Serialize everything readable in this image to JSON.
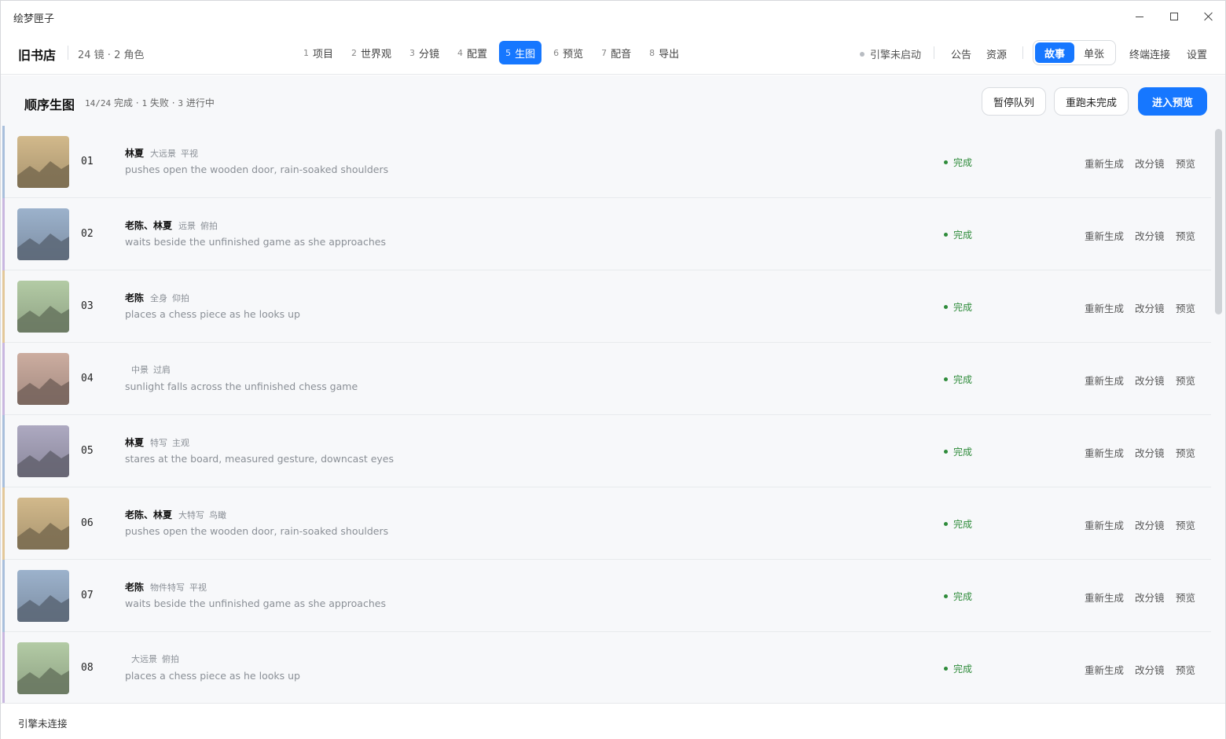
{
  "window": {
    "title": "绘梦匣子"
  },
  "project": {
    "name": "旧书店",
    "meta": "24 镜 · 2 角色"
  },
  "steps": [
    {
      "num": "1",
      "label": "项目",
      "active": false
    },
    {
      "num": "2",
      "label": "世界观",
      "active": false
    },
    {
      "num": "3",
      "label": "分镜",
      "active": false
    },
    {
      "num": "4",
      "label": "配置",
      "active": false
    },
    {
      "num": "5",
      "label": "生图",
      "active": true
    },
    {
      "num": "6",
      "label": "预览",
      "active": false
    },
    {
      "num": "7",
      "label": "配音",
      "active": false
    },
    {
      "num": "8",
      "label": "导出",
      "active": false
    }
  ],
  "header": {
    "engine_status": "引擎未启动",
    "announcement": "公告",
    "assets": "资源",
    "mode_story": "故事",
    "mode_single": "单张",
    "mode_selected": "故事",
    "terminal": "终端连接",
    "settings": "设置"
  },
  "section": {
    "title": "顺序生图",
    "done": "14/24",
    "done_label": "完成",
    "failed": "1",
    "failed_label": "失败",
    "running": "3",
    "running_label": "进行中",
    "pause_button": "暂停队列",
    "rerun_button": "重跑未完成",
    "enter_preview_button": "进入预览"
  },
  "row_actions": {
    "regen": "重新生成",
    "edit": "改分镜",
    "preview": "预览"
  },
  "shots": [
    {
      "num": "01",
      "characters": "林夏",
      "shot_size": "大远景",
      "angle": "平视",
      "description": "pushes open the wooden door, rain-soaked shoulders",
      "status": "完成",
      "accent": "#a9bfdc",
      "tone": "#a8946f"
    },
    {
      "num": "02",
      "characters": "老陈、林夏",
      "shot_size": "远景",
      "angle": "俯拍",
      "description": "waits beside the unfinished game as she approaches",
      "status": "完成",
      "accent": "#c9b7e0",
      "tone": "#7d8ea3"
    },
    {
      "num": "03",
      "characters": "老陈",
      "shot_size": "全身",
      "angle": "仰拍",
      "description": "places a chess piece as he looks up",
      "status": "完成",
      "accent": "#e3c89a",
      "tone": "#8fa284"
    },
    {
      "num": "04",
      "characters": "",
      "shot_size": "中景",
      "angle": "过肩",
      "description": "sunlight falls across the unfinished chess game",
      "status": "完成",
      "accent": "#c9b7e0",
      "tone": "#a38a80"
    },
    {
      "num": "05",
      "characters": "林夏",
      "shot_size": "特写",
      "angle": "主观",
      "description": "stares at the board, measured gesture, downcast eyes",
      "status": "完成",
      "accent": "#a9bfdc",
      "tone": "#8a879a"
    },
    {
      "num": "06",
      "characters": "老陈、林夏",
      "shot_size": "大特写",
      "angle": "鸟瞰",
      "description": "pushes open the wooden door, rain-soaked shoulders",
      "status": "完成",
      "accent": "#e3c89a",
      "tone": "#a8946f"
    },
    {
      "num": "07",
      "characters": "老陈",
      "shot_size": "物件特写",
      "angle": "平视",
      "description": "waits beside the unfinished game as she approaches",
      "status": "完成",
      "accent": "#a9bfdc",
      "tone": "#7d8ea3"
    },
    {
      "num": "08",
      "characters": "",
      "shot_size": "大远景",
      "angle": "俯拍",
      "description": "places a chess piece as he looks up",
      "status": "完成",
      "accent": "#c9b7e0",
      "tone": "#8fa284"
    }
  ],
  "footer": {
    "status": "引擎未连接"
  }
}
